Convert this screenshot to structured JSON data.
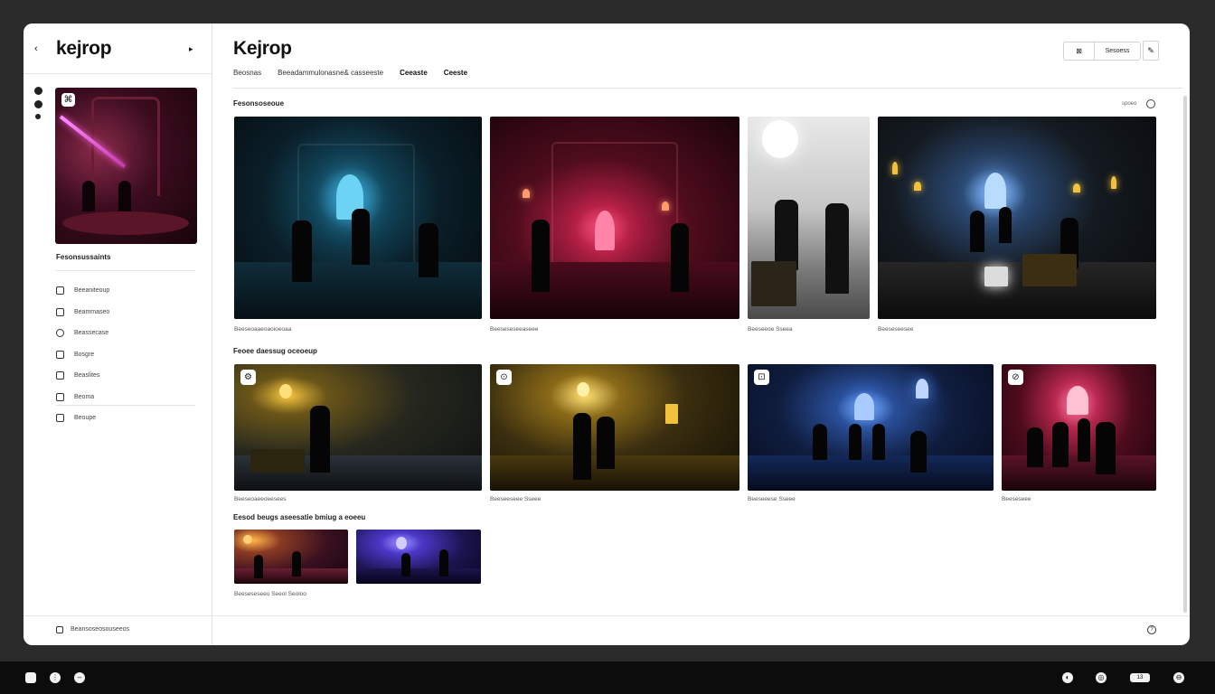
{
  "sidebar": {
    "back_glyph": "‹",
    "brand": "kejrop",
    "forward_glyph": "▸",
    "feature_badge_glyph": "⌘",
    "section_title": "Fesonsussaints",
    "items": [
      {
        "label": "Beeaniteoup",
        "icon": "square-icon"
      },
      {
        "label": "Beammaseo",
        "icon": "chat-icon"
      },
      {
        "label": "Beassecase",
        "icon": "circle-icon"
      },
      {
        "label": "Bosgre",
        "icon": "star-icon"
      },
      {
        "label": "Beaslites",
        "icon": "grid-icon"
      },
      {
        "label": "Beoma",
        "icon": "folder-icon"
      }
    ],
    "extra_item": {
      "label": "Beoupe",
      "icon": "settings-icon"
    },
    "footer_label": "Beansoseosouseeos"
  },
  "header": {
    "title": "Kejrop",
    "tabs": [
      {
        "label": "Beosnas",
        "bold": false
      },
      {
        "label": "Beeadammulonasne& casseeste",
        "bold": false
      },
      {
        "label": "Ceeaste",
        "bold": true
      },
      {
        "label": "Ceeste",
        "bold": true
      }
    ],
    "toolbar": {
      "icon_glyph": "⊠",
      "label": "Sesoess",
      "edit_glyph": "✎"
    }
  },
  "sections": [
    {
      "title": "Fesonsoseoue",
      "more_label": "spoeo",
      "cards": [
        {
          "caption": "Beeseoaaeoaoioeoaa",
          "theme": "teal"
        },
        {
          "caption": "Beeseseseeaseee",
          "theme": "crimson"
        },
        {
          "caption": "Beeseeoe  Sseea",
          "theme": "fog"
        },
        {
          "caption": "Beeseseesee",
          "theme": "gold-hall"
        }
      ]
    },
    {
      "title": "Feoee daessug oceoeup",
      "cards": [
        {
          "caption": "Beeseoaeeoeesees",
          "theme": "amber",
          "badge_glyph": "⚙"
        },
        {
          "caption": "Beeseeseee Sseee",
          "theme": "amber-hall",
          "badge_glyph": "⊙"
        },
        {
          "caption": "Beeseeese Sseee",
          "theme": "blue",
          "badge_glyph": "⊡"
        },
        {
          "caption": "Beeseseee",
          "theme": "rose",
          "badge_glyph": "⊘"
        }
      ]
    },
    {
      "title": "Eesod beugs aseesatie bmiug a eoeeu",
      "cards": [
        {
          "caption": "Beeseseseeu Seeol Seoloo",
          "theme": "ember"
        },
        {
          "caption": "",
          "theme": "violet"
        }
      ]
    }
  ],
  "footer": {
    "help_glyph": "?"
  },
  "taskbar": {
    "left": [
      {
        "glyph": "",
        "icon": "file-icon"
      },
      {
        "glyph": "⋮",
        "icon": "menu-icon"
      },
      {
        "glyph": "–",
        "icon": "minus-icon"
      }
    ],
    "right": [
      {
        "glyph": "◐",
        "icon": "theme-icon"
      },
      {
        "glyph": "◎",
        "icon": "target-icon"
      },
      {
        "glyph": "13",
        "icon": "battery-icon"
      },
      {
        "glyph": "⊖",
        "icon": "power-icon"
      }
    ]
  },
  "colors": {
    "teal": "#3aa9d6",
    "crimson": "#e0355e",
    "gold": "#f2c23d",
    "blue": "#4f8ef5",
    "rose": "#e04a78",
    "violet": "#6a5bff"
  }
}
